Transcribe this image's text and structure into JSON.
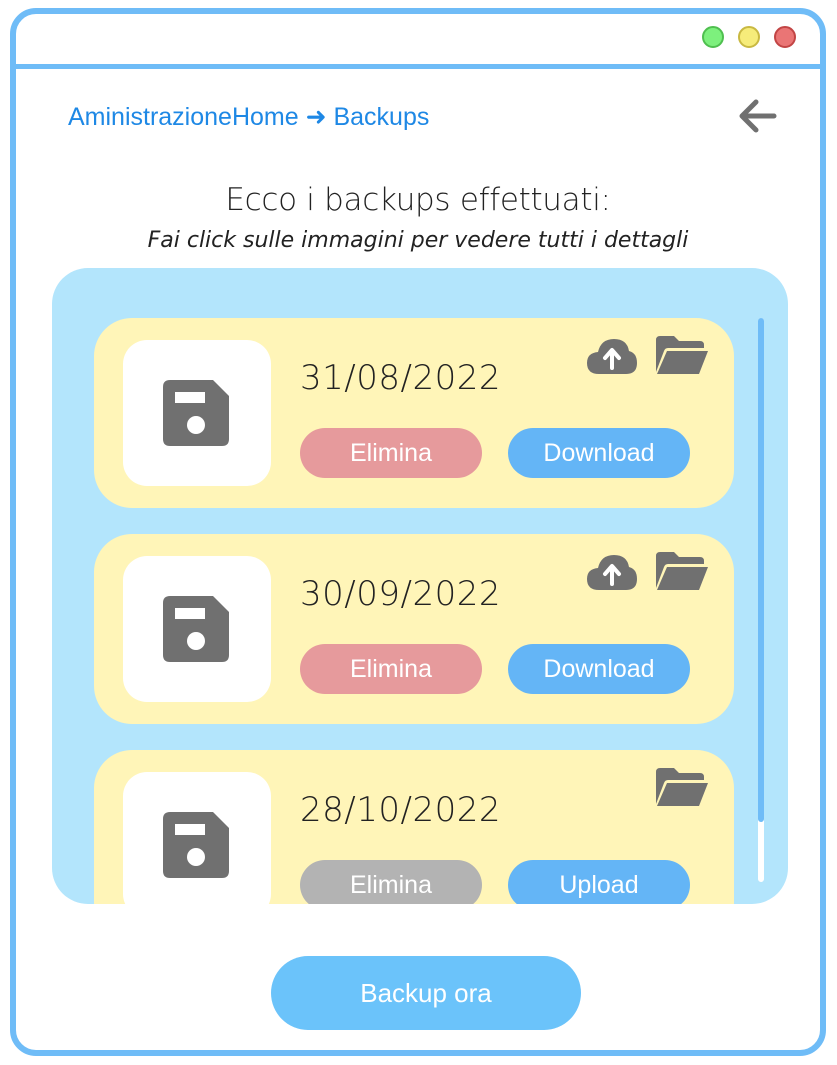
{
  "window": {
    "controls": [
      "green",
      "yellow",
      "red"
    ]
  },
  "breadcrumb": {
    "text": "AministrazioneHome ➜ Backups"
  },
  "header": {
    "back_icon": "arrow-left-icon"
  },
  "heading": "Ecco i backups effettuati:",
  "subheading": "Fai click sulle immagini per vedere tutti i dettagli",
  "backups": [
    {
      "date": "31/08/2022",
      "delete_label": "Elimina",
      "action_label": "Download",
      "icons": [
        "cloud-upload-icon",
        "folder-icon"
      ]
    },
    {
      "date": "30/09/2022",
      "delete_label": "Elimina",
      "action_label": "Download",
      "icons": [
        "cloud-upload-icon",
        "folder-icon"
      ]
    },
    {
      "date": "28/10/2022",
      "delete_label": "Elimina",
      "action_label": "Upload",
      "icons": [
        "folder-icon"
      ]
    }
  ],
  "backup_now_label": "Backup ora",
  "colors": {
    "accent": "#6fbcf7",
    "link": "#1e88e5",
    "panel": "#b3e5fc",
    "card": "#fff5b8",
    "delete": "#e69a9c",
    "delete_disabled": "#b3b3b3",
    "action": "#64b5f6",
    "icon": "#707070"
  }
}
